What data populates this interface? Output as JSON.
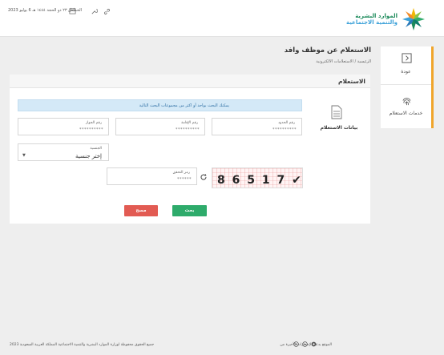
{
  "header": {
    "logo": {
      "line1": "الموارد البشرية",
      "line2": "والتنمية الاجتماعية"
    },
    "date": "الخميس ٢٣ ذو الحجة ١٤٤٤ هـ 6 يوليو 2023",
    "icons": [
      "calendar-icon",
      "tools-icon",
      "link-icon"
    ]
  },
  "sidebar": {
    "items": [
      {
        "label": "عودة",
        "icon": "back-arrow-icon"
      },
      {
        "label": "خدمات الاستعلام",
        "icon": "fingerprint-icon"
      }
    ],
    "accent_color": "#f0a52b"
  },
  "page": {
    "title": "الاستعلام عن موظف وافد",
    "breadcrumb": "الرئيسية / الاستعلامات الالكترونية"
  },
  "card": {
    "title": "الاستعلام",
    "info": "يمكنك البحث بواحد أو اكثر من مجموعات البحث التالية",
    "section_label": "بيانات الاستعلام",
    "fields": {
      "border_number": {
        "label": "رقم الحدود",
        "placeholder": "**********"
      },
      "iqama_number": {
        "label": "رقم الإقامة",
        "placeholder": "**********"
      },
      "passport_number": {
        "label": "رقم الجواز",
        "placeholder": "**********"
      }
    },
    "nationality": {
      "label": "الجنسية",
      "value": "إختر جنسية"
    },
    "captcha": {
      "text": "8 6 5 1 7 ✔"
    },
    "code": {
      "label": "رمز التحقق",
      "placeholder": "******"
    },
    "buttons": {
      "search": "بحث",
      "clear": "مسح"
    }
  },
  "footer": {
    "rights": "جميع الحقوق محفوظة لوزارة الموارد البشرية والتنمية الاجتماعية المملكة العربية السعودية 2023",
    "best_view": "الموقع يدعم الإصدارات الأخيرة من"
  },
  "colors": {
    "primary_green": "#2eab6b",
    "danger_red": "#e25b53",
    "info_blue": "#d4e9f7"
  }
}
